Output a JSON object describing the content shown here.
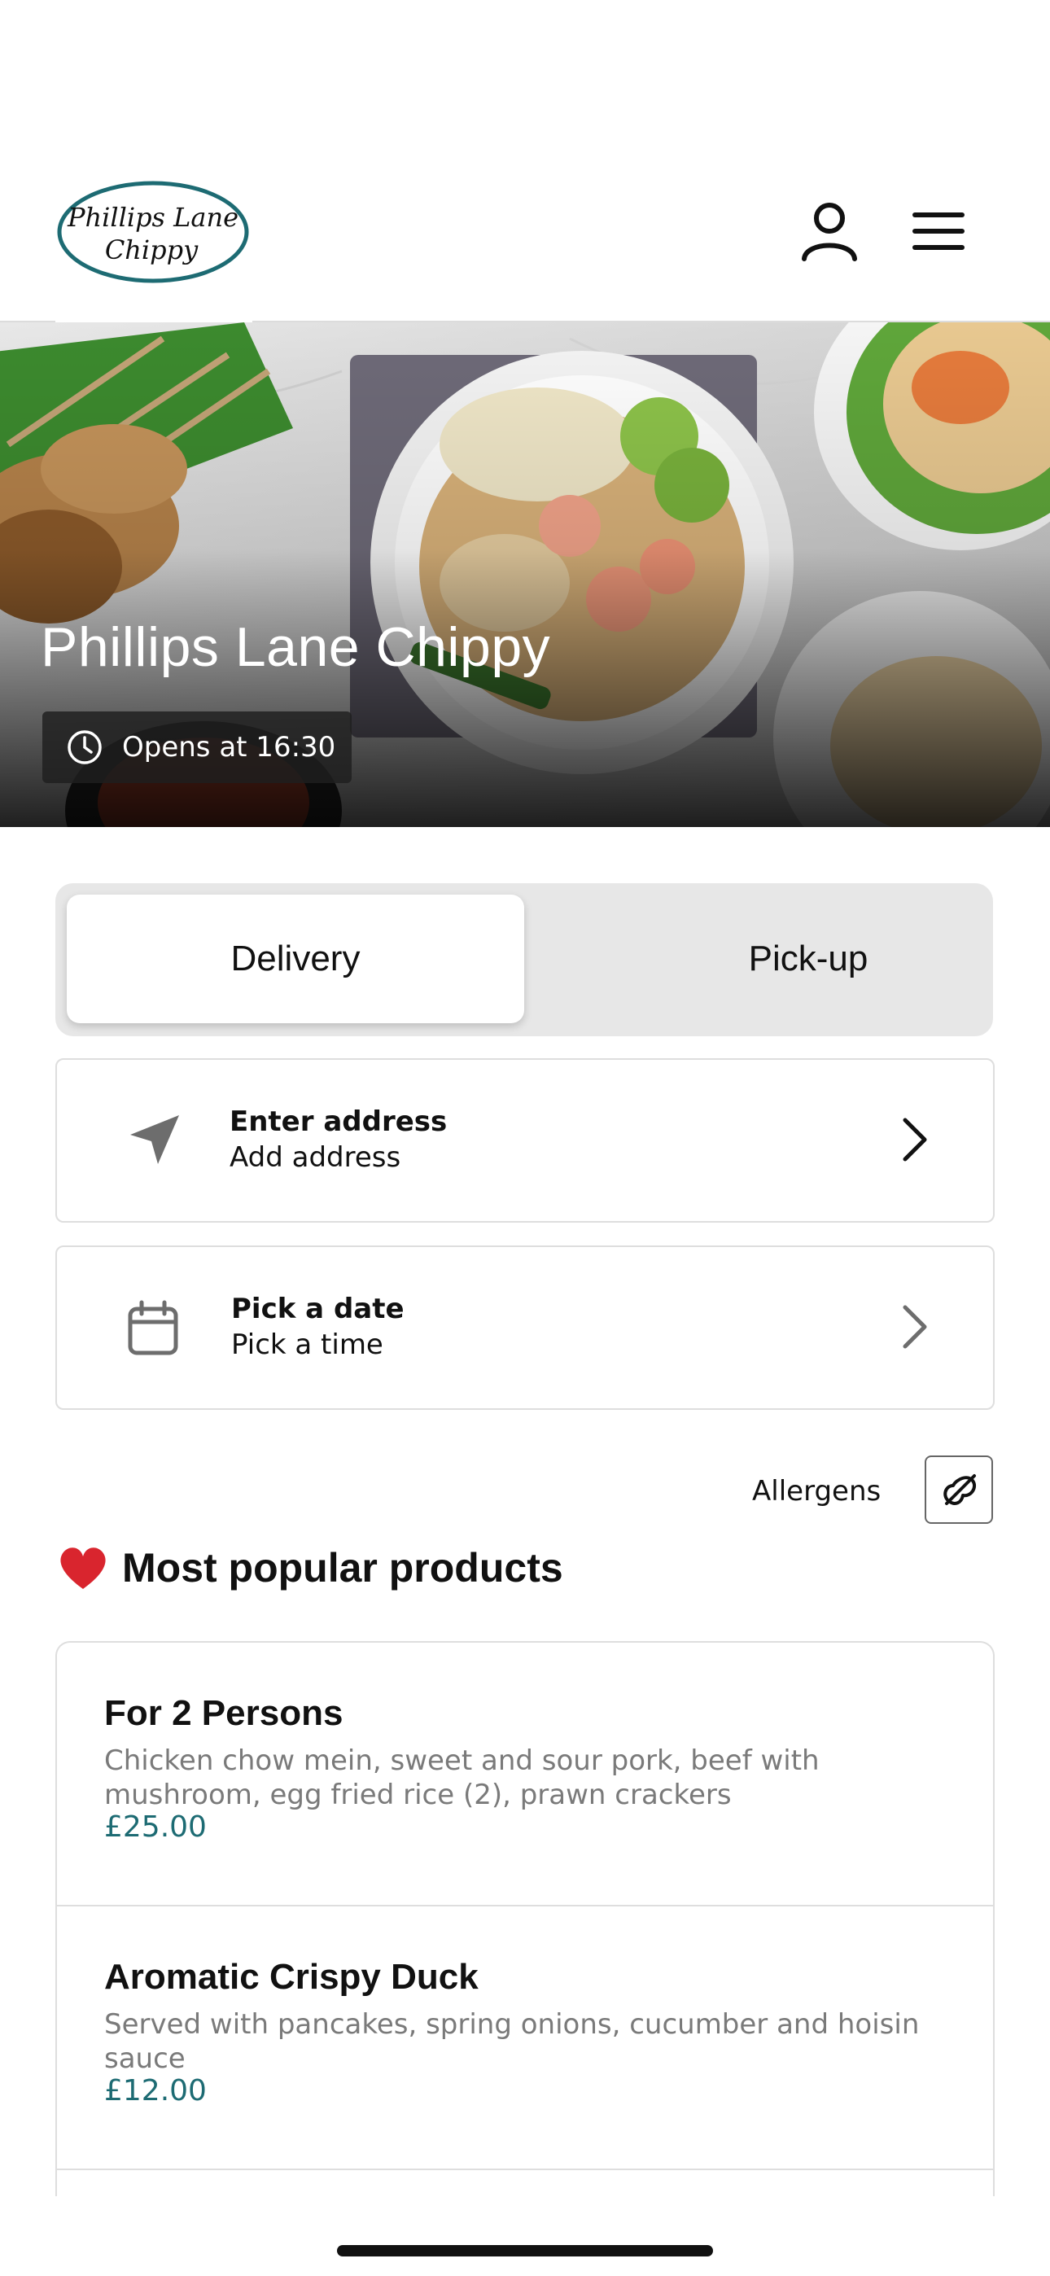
{
  "header": {
    "logo_line1": "Phillips Lane",
    "logo_line2": "Chippy",
    "icons": [
      "user-icon",
      "menu-icon"
    ]
  },
  "hero": {
    "title": "Phillips Lane Chippy",
    "hours": "Opens at 16:30"
  },
  "mode_toggle": {
    "delivery_label": "Delivery",
    "pickup_label": "Pick-up",
    "selected": "Delivery"
  },
  "address_card": {
    "title": "Enter address",
    "subtitle": "Add address"
  },
  "date_card": {
    "title": "Pick a date",
    "subtitle": "Pick a time"
  },
  "allergens": {
    "label": "Allergens"
  },
  "popular": {
    "title": "Most popular products",
    "products": [
      {
        "name": "For 2 Persons",
        "description": "Chicken chow mein, sweet and sour pork, beef with mushroom, egg fried rice (2), prawn crackers",
        "price": "£25.00"
      },
      {
        "name": "Aromatic Crispy Duck",
        "description": "Served with pancakes, spring onions, cucumber and hoisin sauce",
        "price": "£12.00"
      }
    ]
  },
  "colors": {
    "accent": "#1d6b73",
    "logo_ring": "#1d6b73",
    "toggle_bg": "#e7e7e7",
    "heart": "#d9252e"
  }
}
